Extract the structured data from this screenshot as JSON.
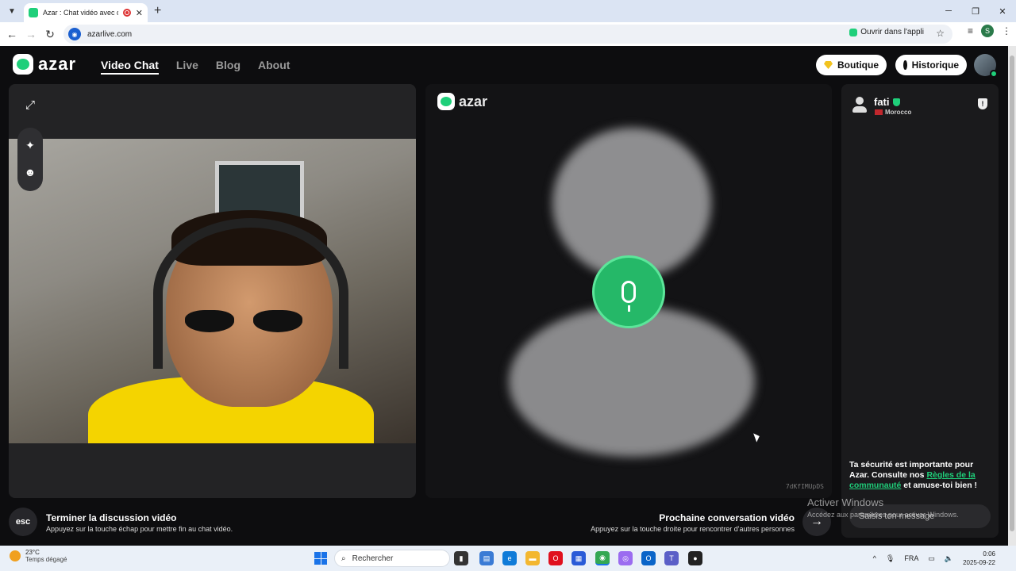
{
  "browser": {
    "tab_title": "Azar : Chat vidéo avec de n",
    "url": "azarlive.com",
    "open_in_app": "Ouvrir dans l'appli",
    "profile_initial": "S"
  },
  "header": {
    "logo": "azar",
    "nav": [
      "Video Chat",
      "Live",
      "Blog",
      "About"
    ],
    "boutique": "Boutique",
    "historique": "Historique"
  },
  "remote": {
    "watermark": "azar",
    "id": "7dKfIMUpDS"
  },
  "chat": {
    "peer_name": "fati",
    "peer_country": "Morocco",
    "safety_text_1": "Ta sécurité est importante pour Azar. Consulte nos ",
    "safety_link": "Règles de la communauté",
    "safety_text_2": " et amuse-toi bien !",
    "input_placeholder": "Saisis ton message"
  },
  "controls": {
    "esc_label": "esc",
    "end_title": "Terminer la discussion vidéo",
    "end_sub": "Appuyez sur la touche échap pour mettre fin au chat vidéo.",
    "next_title": "Prochaine conversation vidéo",
    "next_sub": "Appuyez sur la touche droite pour rencontrer d'autres personnes"
  },
  "windows_activation": {
    "title": "Activer Windows",
    "subtitle": "Accédez aux paramètres pour activer Windows."
  },
  "taskbar": {
    "temperature": "23°C",
    "weather": "Temps dégagé",
    "search": "Rechercher",
    "language": "FRA",
    "time": "0:06",
    "date": "2025-09-22"
  },
  "colors": {
    "brand_green": "#1fcf7a",
    "mic_green": "#25b868"
  }
}
